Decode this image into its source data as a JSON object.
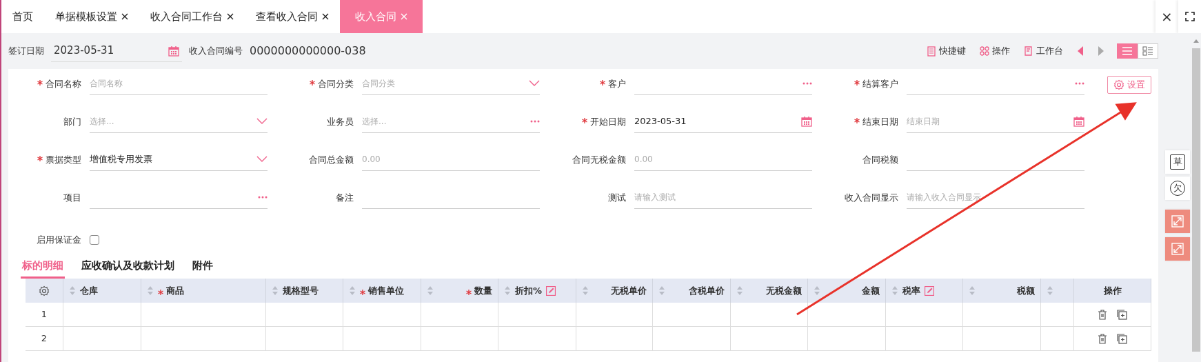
{
  "tabs": [
    {
      "label": "首页",
      "closable": false,
      "selected": false
    },
    {
      "label": "单据模板设置",
      "closable": true,
      "selected": false
    },
    {
      "label": "收入合同工作台",
      "closable": true,
      "selected": false
    },
    {
      "label": "查看收入合同",
      "closable": true,
      "selected": false
    },
    {
      "label": "收入合同",
      "closable": true,
      "selected": true
    }
  ],
  "window_controls": {
    "close": "×"
  },
  "header": {
    "sign_date": {
      "label": "签订日期",
      "value": "2023-05-31"
    },
    "contract_no": {
      "label": "收入合同编号",
      "value": "0000000000000-038"
    },
    "toolbar": [
      {
        "label": "快捷键",
        "kind": "shortcut"
      },
      {
        "label": "操作",
        "kind": "ops"
      },
      {
        "label": "工作台",
        "kind": "desk"
      }
    ],
    "pager": [
      {
        "kind": "prev",
        "disabled": false
      },
      {
        "kind": "next",
        "disabled": true
      }
    ],
    "view_modes": [
      {
        "kind": "list",
        "selected": true
      },
      {
        "kind": "cards",
        "selected": false
      }
    ]
  },
  "form": {
    "fields": [
      {
        "label": "合同名称",
        "required": true,
        "kind": "text",
        "placeholder": "合同名称"
      },
      {
        "label": "合同分类",
        "required": true,
        "kind": "select",
        "placeholder": "合同分类"
      },
      {
        "label": "客户",
        "required": true,
        "kind": "lookup"
      },
      {
        "label": "结算客户",
        "required": true,
        "kind": "lookup"
      },
      {
        "label": "部门",
        "required": false,
        "kind": "select",
        "placeholder": "选择..."
      },
      {
        "label": "业务员",
        "required": false,
        "kind": "lookup",
        "placeholder": "选择..."
      },
      {
        "label": "开始日期",
        "required": true,
        "kind": "date",
        "value": "2023-05-31"
      },
      {
        "label": "结束日期",
        "required": true,
        "kind": "date",
        "placeholder": "结束日期"
      },
      {
        "label": "票据类型",
        "required": true,
        "kind": "select",
        "value": "增值税专用发票"
      },
      {
        "label": "合同总金额",
        "required": false,
        "kind": "text",
        "placeholder": "0.00"
      },
      {
        "label": "合同无税金额",
        "required": false,
        "kind": "text",
        "placeholder": "0.00"
      },
      {
        "label": "合同税额",
        "required": false,
        "kind": "text"
      },
      {
        "label": "项目",
        "required": false,
        "kind": "lookup"
      },
      {
        "label": "备注",
        "required": false,
        "kind": "text"
      },
      {
        "label": "测试",
        "required": false,
        "kind": "text",
        "placeholder": "请输入测试"
      },
      {
        "label": "收入合同显示",
        "required": false,
        "kind": "text",
        "placeholder": "请输入收入合同显示"
      }
    ],
    "deposit": {
      "label": "启用保证金",
      "checked": false
    },
    "settings_button": "设置"
  },
  "detail_tabs": [
    {
      "label": "标的明细",
      "selected": true
    },
    {
      "label": "应收确认及收款计划",
      "selected": false
    },
    {
      "label": "附件",
      "selected": false
    }
  ],
  "table": {
    "columns": [
      {
        "kind": "settings"
      },
      {
        "kind": "text",
        "label": "仓库",
        "required": false
      },
      {
        "kind": "text",
        "label": "商品",
        "required": true
      },
      {
        "kind": "text",
        "label": "规格型号",
        "required": false
      },
      {
        "kind": "text",
        "label": "销售单位",
        "required": true
      },
      {
        "kind": "number",
        "label": "数量",
        "required": true
      },
      {
        "kind": "rate",
        "label": "折扣%",
        "required": false
      },
      {
        "kind": "number",
        "label": "无税单价",
        "required": false
      },
      {
        "kind": "number",
        "label": "含税单价",
        "required": false
      },
      {
        "kind": "number",
        "label": "无税金额",
        "required": false
      },
      {
        "kind": "number",
        "label": "金额",
        "required": false
      },
      {
        "kind": "rate",
        "label": "税率",
        "required": false
      },
      {
        "kind": "number",
        "label": "税额",
        "required": false
      },
      {
        "kind": "blank"
      },
      {
        "kind": "actions",
        "label": "操作"
      }
    ],
    "rows": [
      {
        "number": "1"
      },
      {
        "number": "2"
      }
    ]
  },
  "side_buttons": [
    {
      "label": "草",
      "kind": "note"
    },
    {
      "label": "欠",
      "kind": "circle"
    },
    {
      "kind": "expand"
    },
    {
      "kind": "expand"
    }
  ]
}
